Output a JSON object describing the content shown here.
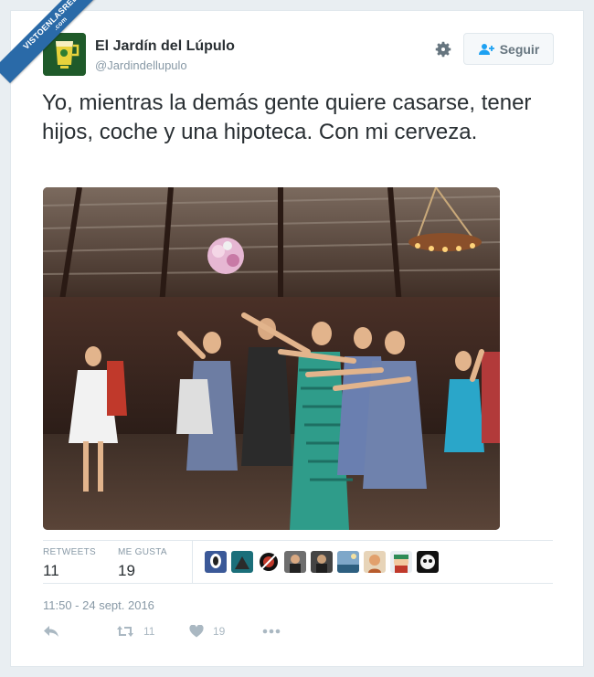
{
  "watermark": {
    "line1": "VISTOENLASREDES",
    "line2": ".com"
  },
  "account": {
    "name": "El Jardín del Lúpulo",
    "handle": "@Jardindellupulo",
    "avatar_icon": "beer-glass-logo-icon"
  },
  "follow_button": {
    "label": "Seguir"
  },
  "tweet": {
    "text": "Yo, mientras la demás gente quiere casarse, tener hijos, coche y una hipoteca. Con mi cerveza."
  },
  "photo": {
    "description_icon": "wedding-bouquet-toss-photo"
  },
  "stats": {
    "retweets_label": "RETWEETS",
    "retweets_count": "11",
    "likes_label": "ME GUSTA",
    "likes_count": "19"
  },
  "timestamp": "11:50 - 24 sept. 2016",
  "actions": {
    "retweet_count": "11",
    "like_count": "19"
  },
  "colors": {
    "accent": "#1da1f2",
    "text": "#292f33",
    "muted": "#8899a6",
    "like": "#aab8c2"
  }
}
